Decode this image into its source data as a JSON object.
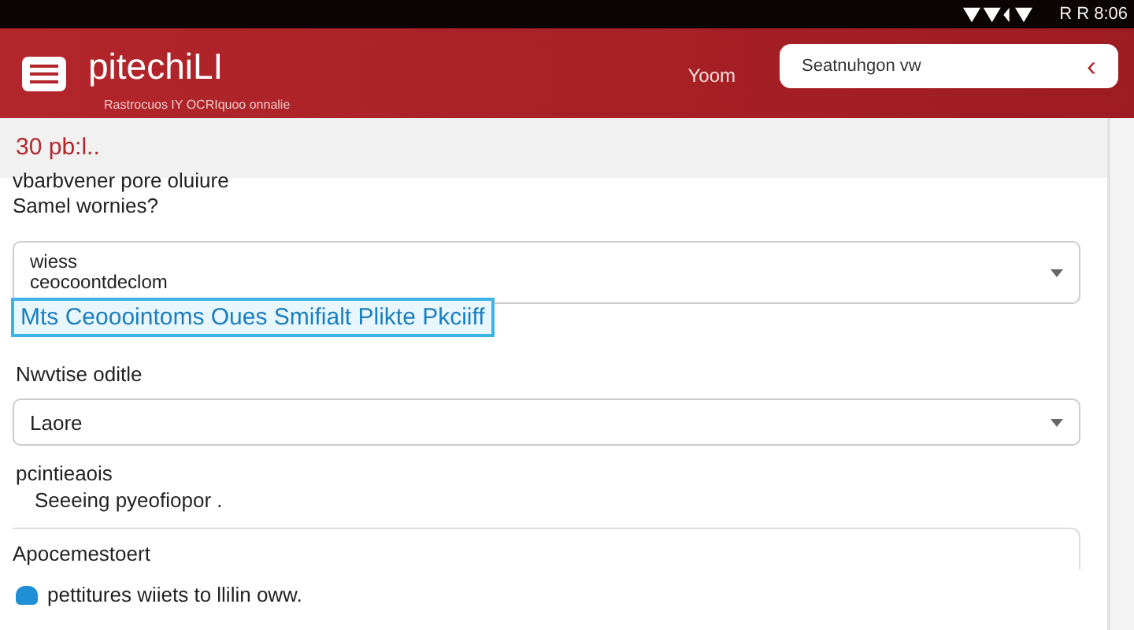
{
  "status_bar": {
    "time": "R R 8:06"
  },
  "header": {
    "title": "pitechiLI",
    "subtitle": "Rastrocuos IY OCRIquoo onnalie",
    "link": "Yoom",
    "search": {
      "value": "Seatnuhgon vw",
      "button": "‹"
    }
  },
  "intro": {
    "count": "30 pb:l..",
    "lines": [
      "vbarbvener pore oluiure",
      "Samel wornies?"
    ]
  },
  "select_1": {
    "lines": [
      "wiess",
      "ceocoontdeclom"
    ]
  },
  "highlight": "Mts Ceooointoms Oues Smifialt Plikte Pkciiff",
  "select_2": {
    "label": "Nwvtise oditle",
    "value": "Laore"
  },
  "section": {
    "label": "pcintieaois",
    "text": "Seeeing pyeofiopor ."
  },
  "field_label": "Apocemestoert",
  "note": "pettitures wiiets to llilin oww."
}
